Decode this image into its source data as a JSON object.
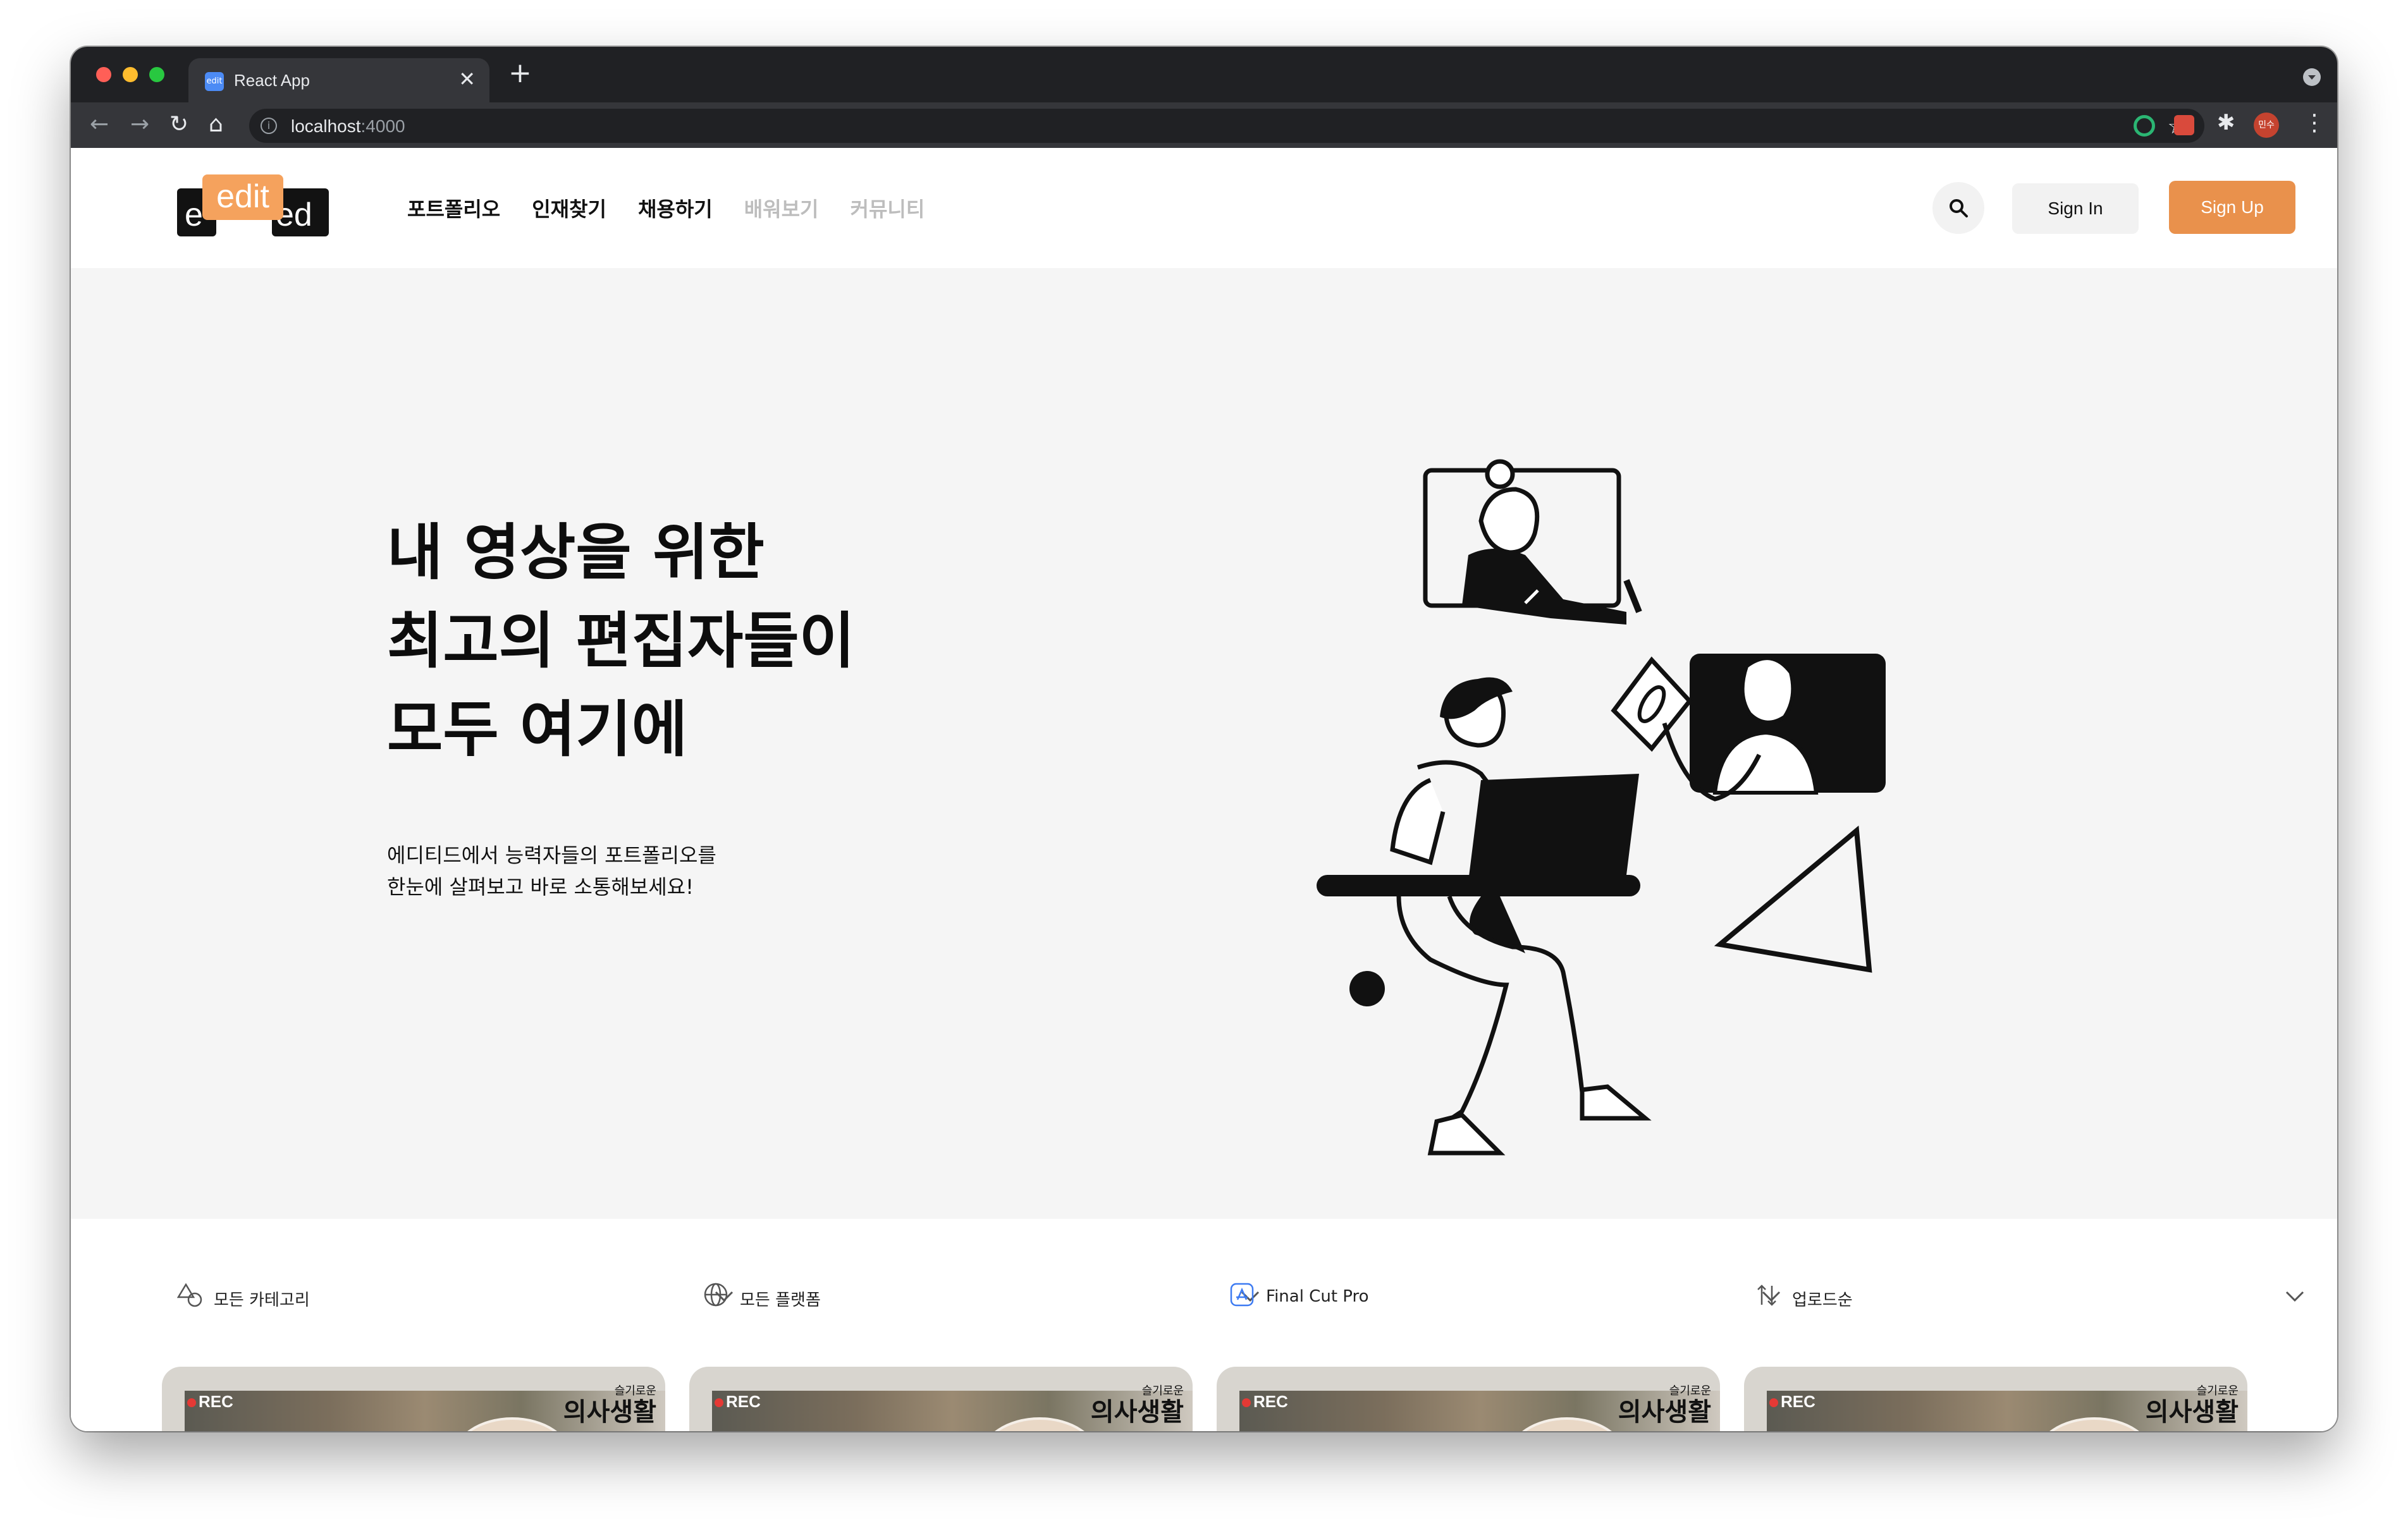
{
  "browser": {
    "tab_title": "React App",
    "favicon_text": "edit",
    "new_tab": "+",
    "tab_close": "✕",
    "url_host": "localhost",
    "url_port": ":4000",
    "profile_initials": "민수"
  },
  "header": {
    "logo": {
      "left": "e",
      "middle": "edit",
      "right": "ed"
    },
    "nav": [
      {
        "label": "포트폴리오",
        "active": true
      },
      {
        "label": "인재찾기",
        "active": true
      },
      {
        "label": "채용하기",
        "active": true
      },
      {
        "label": "배워보기",
        "active": false
      },
      {
        "label": "커뮤니티",
        "active": false
      }
    ],
    "sign_in": "Sign In",
    "sign_up": "Sign Up",
    "accent_color": "#e9914c"
  },
  "hero": {
    "title_lines": [
      "내 영상을 위한",
      "최고의 편집자들이",
      "모두 여기에"
    ],
    "subtitle_lines": [
      "에디티드에서 능력자들의 포트폴리오를",
      "한눈에 살펴보고 바로 소통해보세요!"
    ]
  },
  "filters": [
    {
      "icon": "shapes-icon",
      "label": "모든 카테고리"
    },
    {
      "icon": "globe-icon",
      "label": "모든 플랫폼"
    },
    {
      "icon": "app-store-icon",
      "label": "Final Cut Pro"
    },
    {
      "icon": "sort-icon",
      "label": "업로드순"
    }
  ],
  "cards": [
    {
      "rec": "REC",
      "show_small": "슬기로운",
      "show_big": "의사생활"
    },
    {
      "rec": "REC",
      "show_small": "슬기로운",
      "show_big": "의사생활"
    },
    {
      "rec": "REC",
      "show_small": "슬기로운",
      "show_big": "의사생활"
    },
    {
      "rec": "REC",
      "show_small": "슬기로운",
      "show_big": "의사생활"
    }
  ]
}
